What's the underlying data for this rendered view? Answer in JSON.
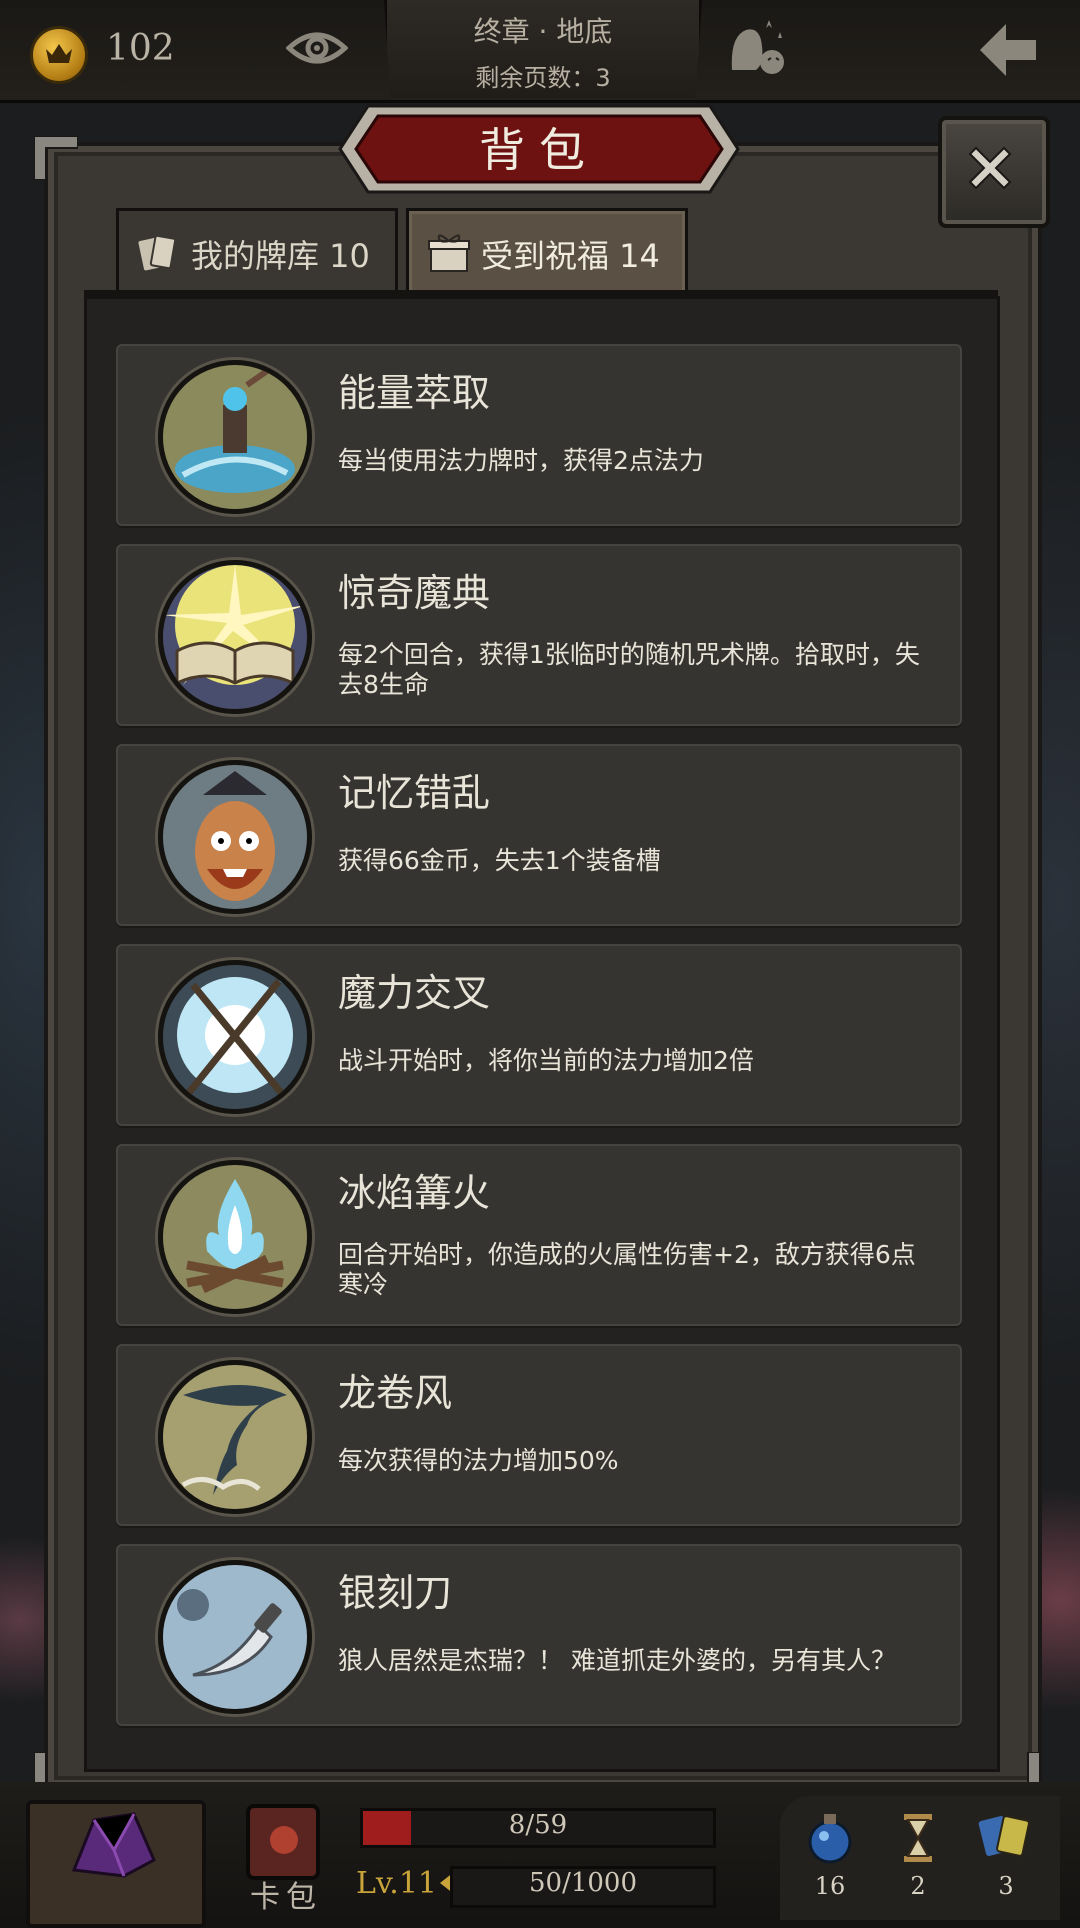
{
  "topbar": {
    "coins": "102",
    "chapter_title": "终章 · 地底",
    "pages_left": "剩余页数：3"
  },
  "panel": {
    "title": "背包",
    "tabs": [
      {
        "label": "我的牌库 10",
        "active": false
      },
      {
        "label": "受到祝福 14",
        "active": true
      }
    ]
  },
  "blessings": [
    {
      "name": "能量萃取",
      "desc": "每当使用法力牌时，获得2点法力",
      "icon": "energy-extract-icon"
    },
    {
      "name": "惊奇魔典",
      "desc": "每2个回合，获得1张临时的随机咒术牌。拾取时，失去8生命",
      "icon": "spellbook-icon"
    },
    {
      "name": "记忆错乱",
      "desc": "获得66金币，失去1个装备槽",
      "icon": "confused-man-icon"
    },
    {
      "name": "魔力交叉",
      "desc": "战斗开始时，将你当前的法力增加2倍",
      "icon": "crossed-staffs-icon"
    },
    {
      "name": "冰焰篝火",
      "desc": "回合开始时，你造成的火属性伤害+2，敌方获得6点寒冷",
      "icon": "ice-bonfire-icon"
    },
    {
      "name": "龙卷风",
      "desc": "每次获得的法力增加50%",
      "icon": "tornado-icon"
    },
    {
      "name": "银刻刀",
      "desc": "狼人居然是杰瑞？！ 难道抓走外婆的，另有其人？",
      "icon": "silver-knife-icon"
    }
  ],
  "bottombar": {
    "deck_label": "卡包",
    "hp_text": "8/59",
    "hp_fraction": 0.136,
    "level": "Lv.11",
    "xp_text": "50/1000",
    "potions": "16",
    "hourglass": "2",
    "cards": "3"
  },
  "colors": {
    "accent_red": "#7a1414",
    "gold": "#c8a43a",
    "card_bg": "#353431"
  }
}
